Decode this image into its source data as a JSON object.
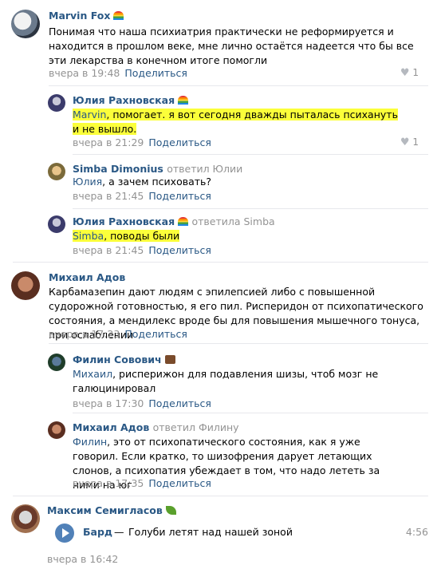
{
  "comments": [
    {
      "author": "Marvin Fox",
      "text": "Понимая что наша психиатрия практически не реформируется и находится в прошлом веке, мне лично остаётся надеется что бы все эти лекарства в конечном итоге помогли",
      "time": "вчера в 19:48",
      "share": "Поделиться",
      "likes": "1"
    },
    {
      "author": "Юлия Рахновская",
      "mention": "Marvin",
      "text": ", помогает. я вот сегодня дважды пыталась психануть и не вышло.",
      "time": "вчера в 21:29",
      "share": "Поделиться",
      "likes": "1"
    },
    {
      "author": "Simba Dimonius",
      "replied_to": "ответил Юлии",
      "mention": "Юлия",
      "text": ", а зачем психовать?",
      "time": "вчера в 21:45",
      "share": "Поделиться"
    },
    {
      "author": "Юлия Рахновская",
      "replied_to": "ответила Simba",
      "mention": "Simba",
      "text": ", поводы были",
      "time": "вчера в 21:45",
      "share": "Поделиться"
    },
    {
      "author": "Михаил Адов",
      "text": "Карбамазепин дают людям с эпилепсией либо с повышенной судорожной готовностью, я его пил. Рисперидон от психопатического состояния, а мендилекс вроде бы для повышения мышечного тонуса, при ослаблении",
      "time": "вчера в 17:23",
      "share": "Поделиться"
    },
    {
      "author": "Филин Совович",
      "mention": "Михаил",
      "text": ", рисперижон для подавления шизы, чтоб мозг не галюцинировал",
      "time": "вчера в 17:30",
      "share": "Поделиться"
    },
    {
      "author": "Михаил Адов",
      "replied_to": "ответил Филину",
      "mention": "Филин",
      "text": ", это от психопатического состояния, как я уже говорил. Если кратко, то шизофрения дарует летающих слонов, а психопатия убеждает в том, что надо лететь за ними на юг",
      "time": "вчера в 17:35",
      "share": "Поделиться"
    },
    {
      "author": "Максим Семигласов",
      "time": "вчера в 16:42",
      "audio": {
        "artist": "Бард",
        "dash": "—",
        "title": "Голуби летят над нашей зоной",
        "duration": "4:56"
      }
    }
  ]
}
